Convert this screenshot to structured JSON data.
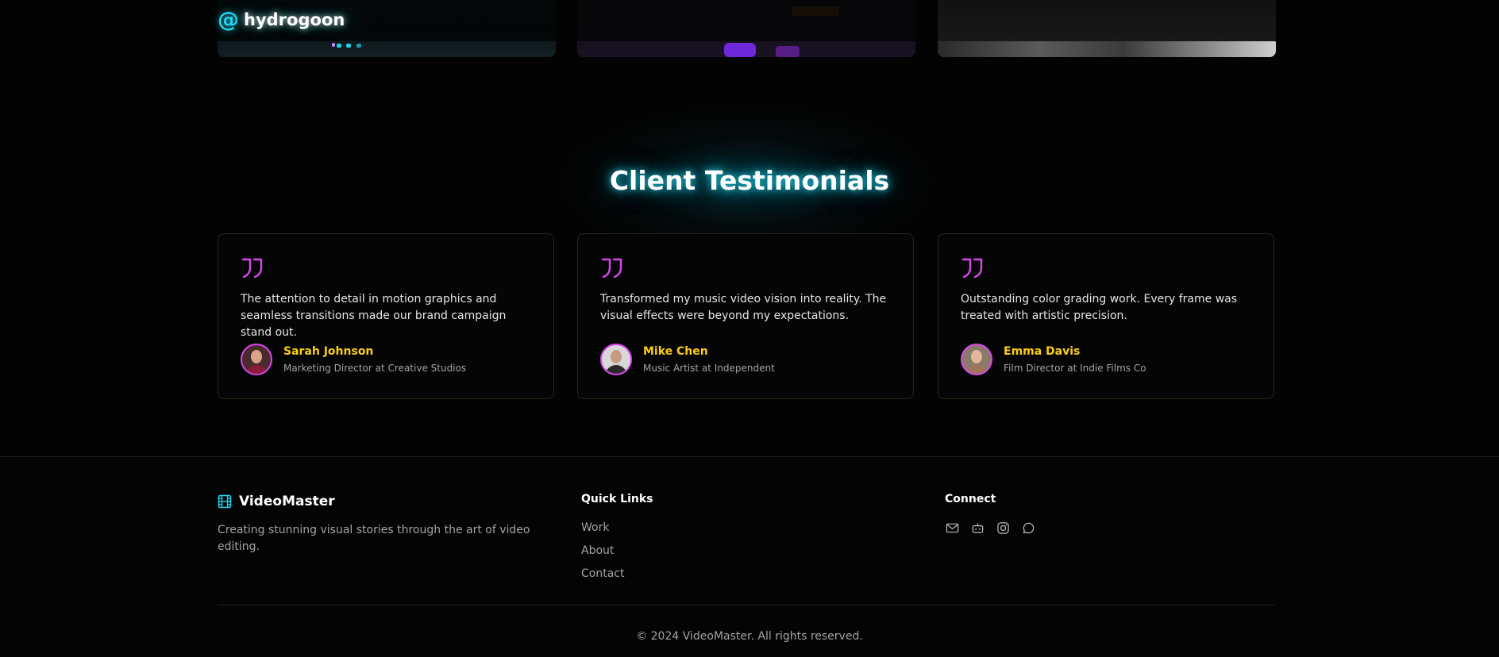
{
  "header": {
    "brand_symbol": "@",
    "brand_name": "hydrogoon"
  },
  "testimonials": {
    "title": "Client Testimonials",
    "items": [
      {
        "quote": "The attention to detail in motion graphics and seamless transitions made our brand campaign stand out.",
        "name": "Sarah Johnson",
        "role": "Marketing Director at Creative Studios"
      },
      {
        "quote": "Transformed my music video vision into reality. The visual effects were beyond my expectations.",
        "name": "Mike Chen",
        "role": "Music Artist at Independent"
      },
      {
        "quote": "Outstanding color grading work. Every frame was treated with artistic precision.",
        "name": "Emma Davis",
        "role": "Film Director at Indie Films Co"
      }
    ]
  },
  "footer": {
    "brand_name": "VideoMaster",
    "description": "Creating stunning visual stories through the art of video editing.",
    "quick_links_title": "Quick Links",
    "links": [
      "Work",
      "About",
      "Contact"
    ],
    "connect_title": "Connect",
    "social_icons": [
      "mail-icon",
      "bot-icon",
      "instagram-icon",
      "chat-icon"
    ],
    "copyright": "© 2024 VideoMaster. All rights reserved."
  },
  "colors": {
    "accent_cyan": "#22d3ee",
    "accent_magenta": "#d946ef",
    "accent_yellow": "#facc15",
    "background": "#030303"
  }
}
